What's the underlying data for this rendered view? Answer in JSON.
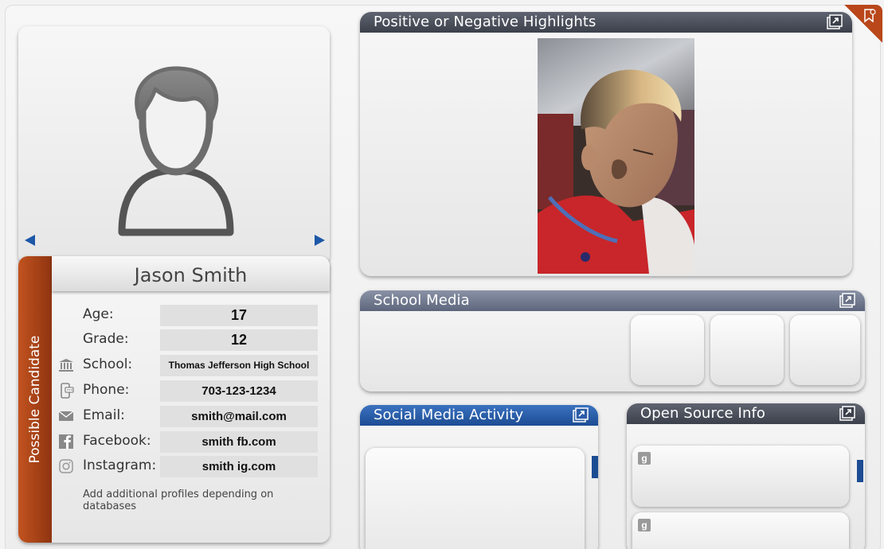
{
  "avatar": {
    "icon": "user-silhouette-icon"
  },
  "profile": {
    "status_tab": "Possible Candidate",
    "name": "Jason Smith",
    "fields": [
      {
        "label": "Age:",
        "value": "17",
        "icon": ""
      },
      {
        "label": "Grade:",
        "value": "12",
        "icon": ""
      },
      {
        "label": "School:",
        "value": "Thomas Jefferson High School",
        "icon": "school-icon"
      },
      {
        "label": "Phone:",
        "value": "703-123-1234",
        "icon": "phone-icon"
      },
      {
        "label": "Email:",
        "value": "smith@mail.com",
        "icon": "email-icon"
      },
      {
        "label": "Facebook:",
        "value": "smith fb.com",
        "icon": "facebook-icon"
      },
      {
        "label": "Instagram:",
        "value": "smith ig.com",
        "icon": "instagram-icon"
      }
    ],
    "note": "Add additional profiles depending on databases"
  },
  "panels": {
    "highlights": {
      "title": "Positive or Negative Highlights"
    },
    "school_media": {
      "title": "School Media"
    },
    "social": {
      "title": "Social Media Activity"
    },
    "opensource": {
      "title": "Open Source Info",
      "badge": "g"
    }
  },
  "colors": {
    "accent_orange": "#b9471a",
    "accent_blue": "#1c4c93",
    "panel_dark": "#3b404b"
  }
}
